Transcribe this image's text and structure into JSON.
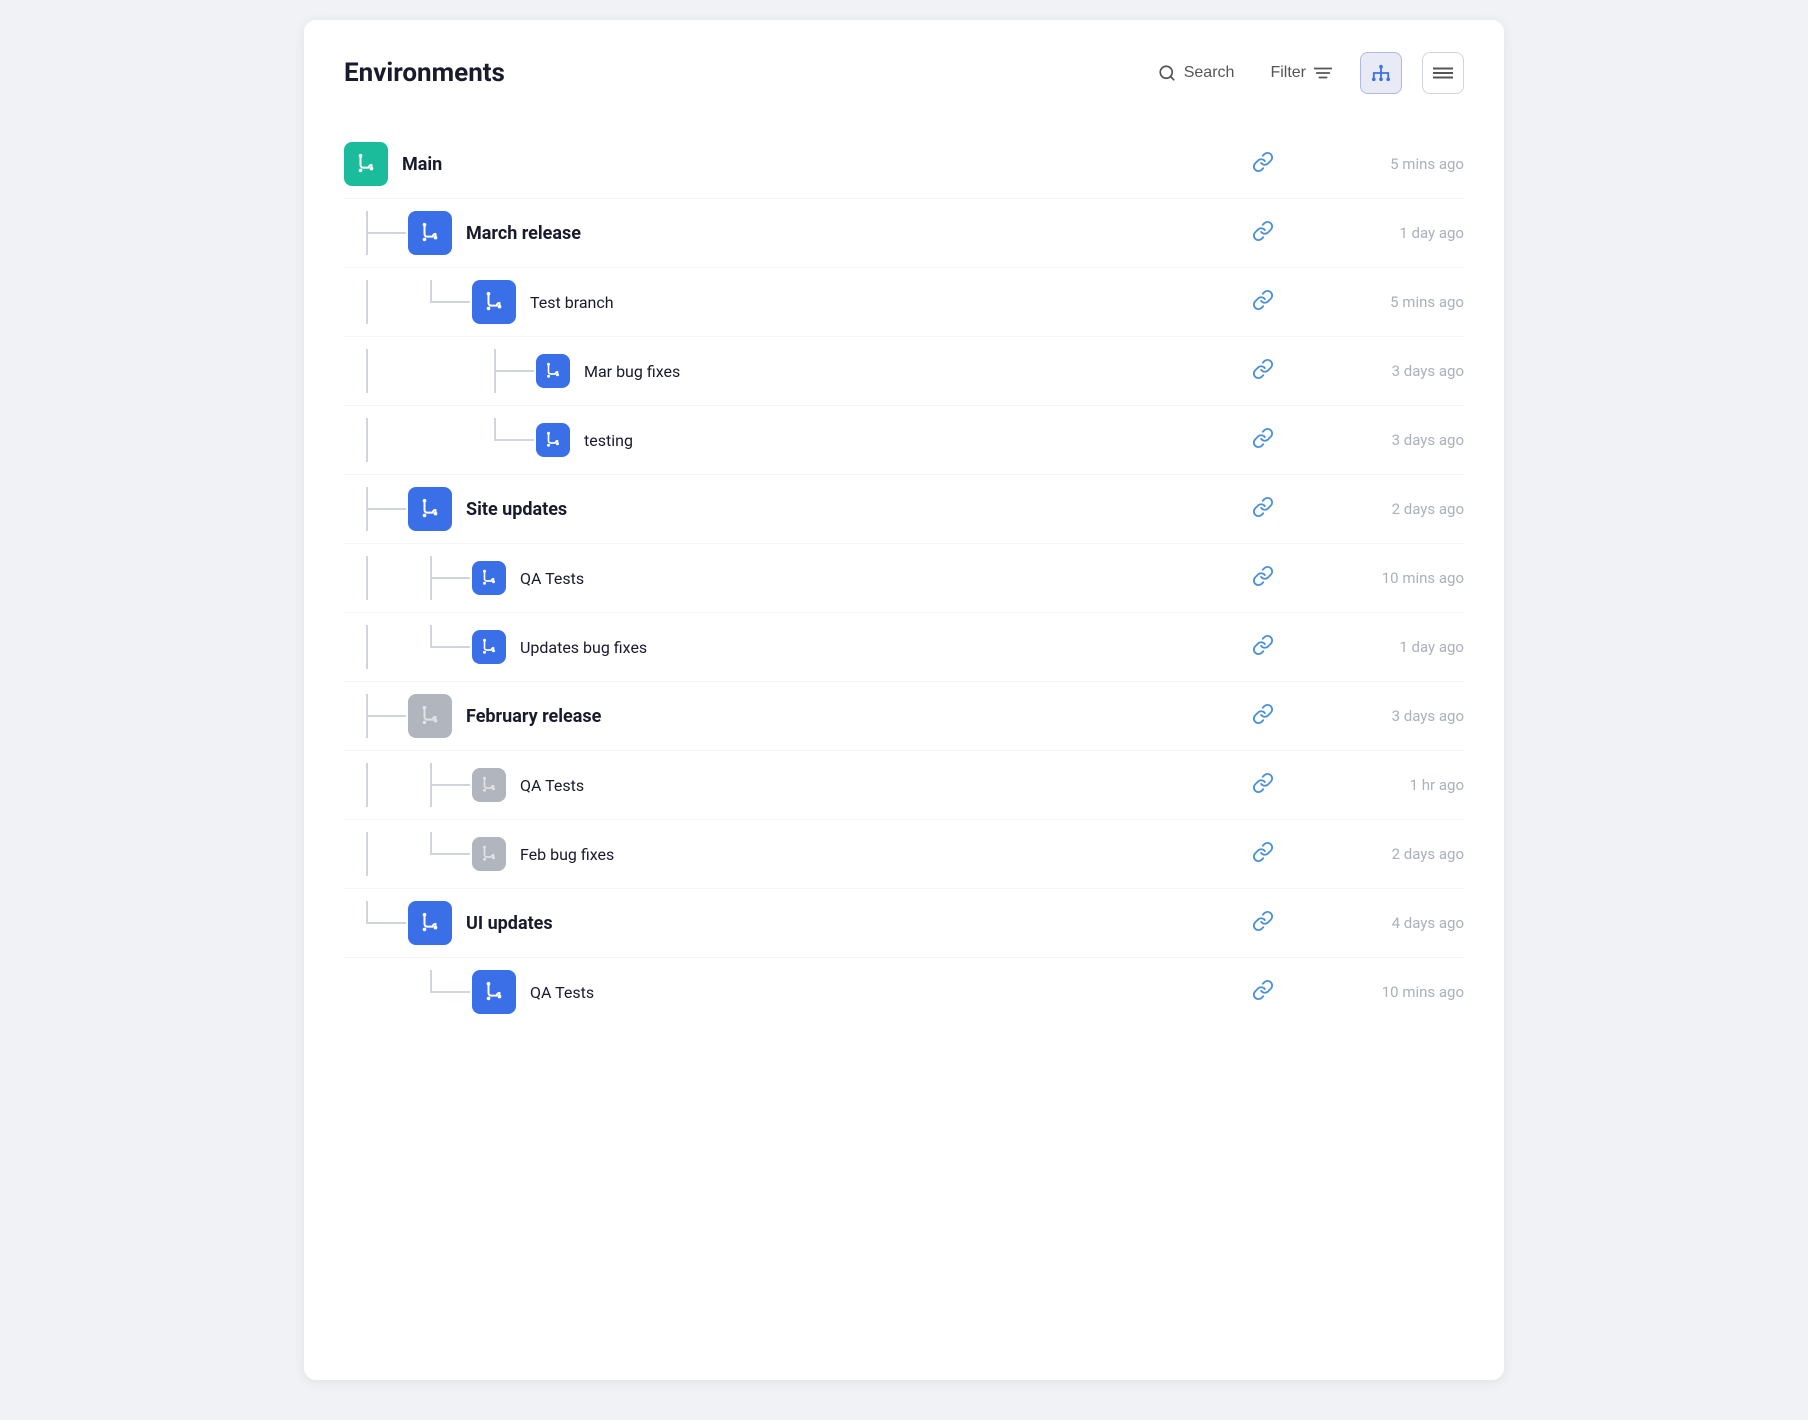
{
  "header": {
    "title": "Environments",
    "search_label": "Search",
    "filter_label": "Filter"
  },
  "toolbar": {
    "search_placeholder": "Search"
  },
  "items": [
    {
      "id": "main",
      "name": "Main",
      "level": 0,
      "icon_type": "teal",
      "bold": true,
      "timestamp": "5 mins ago"
    },
    {
      "id": "march-release",
      "name": "March release",
      "level": 1,
      "icon_type": "blue",
      "bold": true,
      "timestamp": "1 day ago"
    },
    {
      "id": "test-branch",
      "name": "Test branch",
      "level": 2,
      "icon_type": "blue",
      "bold": false,
      "timestamp": "5 mins ago"
    },
    {
      "id": "mar-bug-fixes",
      "name": "Mar bug fixes",
      "level": 3,
      "icon_type": "blue-sm",
      "bold": false,
      "timestamp": "3 days ago"
    },
    {
      "id": "testing",
      "name": "testing",
      "level": 3,
      "icon_type": "blue-sm",
      "bold": false,
      "timestamp": "3 days ago"
    },
    {
      "id": "site-updates",
      "name": "Site updates",
      "level": 1,
      "icon_type": "blue",
      "bold": true,
      "timestamp": "2 days ago"
    },
    {
      "id": "qa-tests-1",
      "name": "QA Tests",
      "level": 2,
      "icon_type": "blue-sm",
      "bold": false,
      "timestamp": "10 mins ago"
    },
    {
      "id": "updates-bug-fixes",
      "name": "Updates bug fixes",
      "level": 2,
      "icon_type": "blue-sm",
      "bold": false,
      "timestamp": "1 day ago"
    },
    {
      "id": "february-release",
      "name": "February release",
      "level": 1,
      "icon_type": "gray",
      "bold": true,
      "timestamp": "3 days ago"
    },
    {
      "id": "qa-tests-2",
      "name": "QA Tests",
      "level": 2,
      "icon_type": "gray-sm",
      "bold": false,
      "timestamp": "1 hr ago"
    },
    {
      "id": "feb-bug-fixes",
      "name": "Feb bug fixes",
      "level": 2,
      "icon_type": "gray-sm",
      "bold": false,
      "timestamp": "2 days ago"
    },
    {
      "id": "ui-updates",
      "name": "UI updates",
      "level": 1,
      "icon_type": "blue",
      "bold": true,
      "timestamp": "4 days ago"
    },
    {
      "id": "qa-tests-3",
      "name": "QA Tests",
      "level": 2,
      "icon_type": "blue",
      "bold": false,
      "timestamp": "10 mins ago"
    }
  ]
}
